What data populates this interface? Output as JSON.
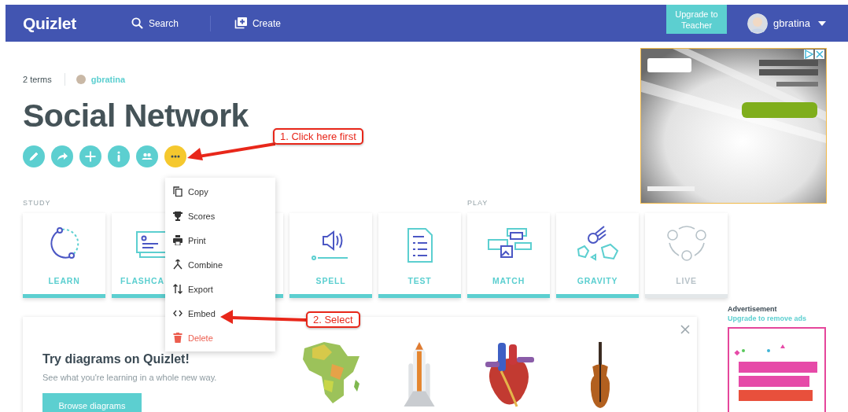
{
  "header": {
    "logo": "Quizlet",
    "nav": [
      {
        "kind": "search",
        "label": "Search"
      },
      {
        "kind": "create",
        "label": "Create"
      }
    ],
    "upgrade_button": "Upgrade to Teacher",
    "user": "gbratina"
  },
  "set": {
    "terms": "2 terms",
    "author": "gbratina",
    "title": "Social Network",
    "actions": [
      {
        "kind": "edit",
        "selected": false
      },
      {
        "kind": "share",
        "selected": false
      },
      {
        "kind": "add",
        "selected": false
      },
      {
        "kind": "info",
        "selected": false
      },
      {
        "kind": "people",
        "selected": false
      },
      {
        "kind": "more",
        "selected": true
      }
    ]
  },
  "sections": [
    {
      "label": "STUDY",
      "modes": [
        {
          "kind": "learn",
          "label": "LEARN",
          "disabled": false
        },
        {
          "kind": "flashcards",
          "label": "FLASHCA",
          "disabled": false
        },
        {
          "kind": "covered",
          "disabled": false
        },
        {
          "kind": "spell",
          "label": "SPELL",
          "disabled": false
        },
        {
          "kind": "test",
          "label": "TEST",
          "disabled": false
        }
      ]
    },
    {
      "label": "PLAY",
      "modes": [
        {
          "kind": "match",
          "label": "MATCH",
          "disabled": false
        },
        {
          "kind": "gravity",
          "label": "GRAVITY",
          "disabled": false
        },
        {
          "kind": "live",
          "label": "LIVE",
          "disabled": true
        }
      ]
    }
  ],
  "menu": [
    {
      "kind": "copy",
      "label": "Copy",
      "destructive": false
    },
    {
      "kind": "scores",
      "label": "Scores",
      "destructive": false
    },
    {
      "kind": "print",
      "label": "Print",
      "destructive": false
    },
    {
      "kind": "combine",
      "label": "Combine",
      "destructive": false
    },
    {
      "kind": "export",
      "label": "Export",
      "destructive": false
    },
    {
      "kind": "embed",
      "label": "Embed",
      "destructive": false
    },
    {
      "kind": "delete",
      "label": "Delete",
      "destructive": true
    }
  ],
  "promo": {
    "title": "Try diagrams on Quizlet!",
    "subtitle": "See what you're learning in a whole new way.",
    "button": "Browse diagrams"
  },
  "sidebar": {
    "ad_label": "Advertisement",
    "remove_ads_link": "Upgrade to remove ads"
  },
  "annotations": [
    {
      "text": "1. Click here first"
    },
    {
      "text": "2. Select"
    }
  ]
}
